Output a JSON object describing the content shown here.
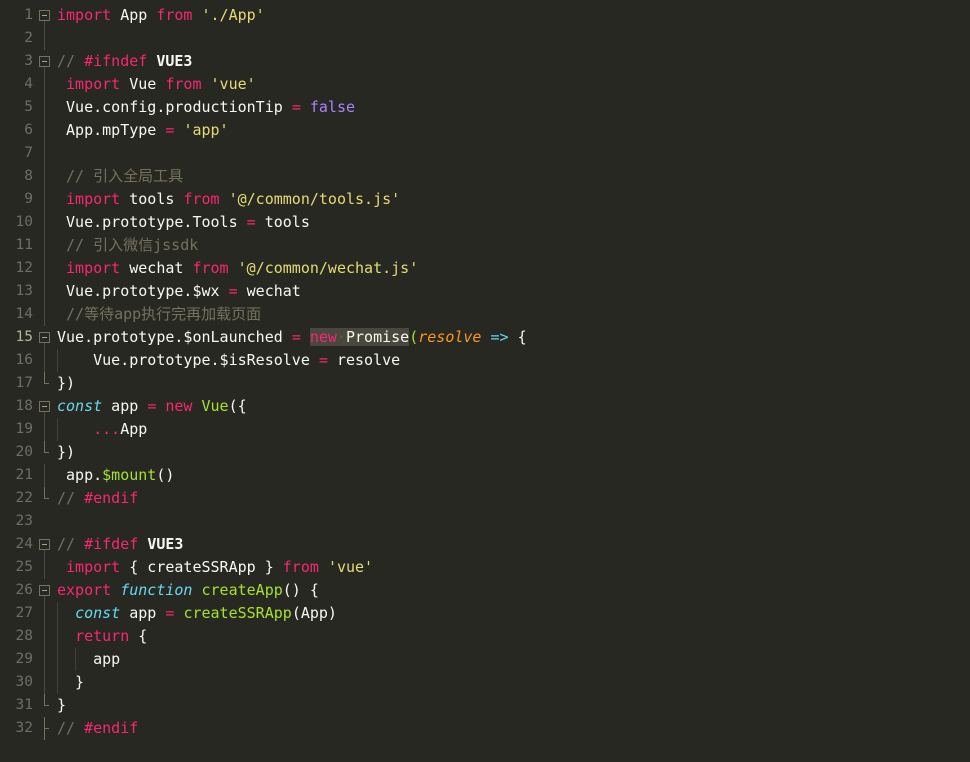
{
  "editor": {
    "theme_name": "monokai",
    "background": "#272822",
    "foreground": "#f8f8f2",
    "gutter_color": "#6d6f63",
    "active_gutter_color": "#b4b49f",
    "selection_background": "#49483e",
    "total_lines": 32,
    "active_line": 15,
    "colors": {
      "keyword": "#f92672",
      "storage": "#66d9ef",
      "string": "#e6db74",
      "comment": "#75715e",
      "constant": "#ae81ff",
      "function": "#a6e22e",
      "parameter": "#fd971f",
      "plain": "#f8f8f2"
    }
  },
  "lines": [
    {
      "number": "1",
      "fold": "open",
      "guides": 0,
      "tokens": [
        {
          "text": "import",
          "cls": "t-kw"
        },
        {
          "text": " App ",
          "cls": "t-plain"
        },
        {
          "text": "from",
          "cls": "t-kw"
        },
        {
          "text": " ",
          "cls": "t-plain"
        },
        {
          "text": "'./App'",
          "cls": "t-str"
        }
      ]
    },
    {
      "number": "2",
      "fold": "bar",
      "guides": 0,
      "tokens": []
    },
    {
      "number": "3",
      "fold": "open",
      "guides": 0,
      "tokens": [
        {
          "text": "// ",
          "cls": "t-com"
        },
        {
          "text": "#ifndef",
          "cls": "t-kw"
        },
        {
          "text": " ",
          "cls": "t-plain"
        },
        {
          "text": "VUE3",
          "cls": "t-bold"
        }
      ]
    },
    {
      "number": "4",
      "fold": "bar",
      "guides": 0,
      "tokens": [
        {
          "text": " ",
          "cls": "t-plain"
        },
        {
          "text": "import",
          "cls": "t-kw"
        },
        {
          "text": " Vue ",
          "cls": "t-plain"
        },
        {
          "text": "from",
          "cls": "t-kw"
        },
        {
          "text": " ",
          "cls": "t-plain"
        },
        {
          "text": "'vue'",
          "cls": "t-str"
        }
      ]
    },
    {
      "number": "5",
      "fold": "bar",
      "guides": 0,
      "tokens": [
        {
          "text": " Vue.config.productionTip ",
          "cls": "t-plain"
        },
        {
          "text": "=",
          "cls": "t-op"
        },
        {
          "text": " ",
          "cls": "t-plain"
        },
        {
          "text": "false",
          "cls": "t-num"
        }
      ]
    },
    {
      "number": "6",
      "fold": "bar",
      "guides": 0,
      "tokens": [
        {
          "text": " App.mpType ",
          "cls": "t-plain"
        },
        {
          "text": "=",
          "cls": "t-op"
        },
        {
          "text": " ",
          "cls": "t-plain"
        },
        {
          "text": "'app'",
          "cls": "t-str"
        }
      ]
    },
    {
      "number": "7",
      "fold": "bar",
      "guides": 0,
      "tokens": []
    },
    {
      "number": "8",
      "fold": "bar",
      "guides": 0,
      "tokens": [
        {
          "text": " // 引入全局工具",
          "cls": "t-com"
        }
      ]
    },
    {
      "number": "9",
      "fold": "bar",
      "guides": 0,
      "tokens": [
        {
          "text": " ",
          "cls": "t-plain"
        },
        {
          "text": "import",
          "cls": "t-kw"
        },
        {
          "text": " tools ",
          "cls": "t-plain"
        },
        {
          "text": "from",
          "cls": "t-kw"
        },
        {
          "text": " ",
          "cls": "t-plain"
        },
        {
          "text": "'@/common/tools.js'",
          "cls": "t-str"
        }
      ]
    },
    {
      "number": "10",
      "fold": "bar",
      "guides": 0,
      "tokens": [
        {
          "text": " Vue.prototype.Tools ",
          "cls": "t-plain"
        },
        {
          "text": "=",
          "cls": "t-op"
        },
        {
          "text": " tools",
          "cls": "t-plain"
        }
      ]
    },
    {
      "number": "11",
      "fold": "bar",
      "guides": 0,
      "tokens": [
        {
          "text": " // 引入微信jssdk",
          "cls": "t-com"
        }
      ]
    },
    {
      "number": "12",
      "fold": "bar",
      "guides": 0,
      "tokens": [
        {
          "text": " ",
          "cls": "t-plain"
        },
        {
          "text": "import",
          "cls": "t-kw"
        },
        {
          "text": " wechat ",
          "cls": "t-plain"
        },
        {
          "text": "from",
          "cls": "t-kw"
        },
        {
          "text": " ",
          "cls": "t-plain"
        },
        {
          "text": "'@/common/wechat.js'",
          "cls": "t-str"
        }
      ]
    },
    {
      "number": "13",
      "fold": "bar",
      "guides": 0,
      "tokens": [
        {
          "text": " Vue.prototype.$wx ",
          "cls": "t-plain"
        },
        {
          "text": "=",
          "cls": "t-op"
        },
        {
          "text": " wechat",
          "cls": "t-plain"
        }
      ]
    },
    {
      "number": "14",
      "fold": "bar",
      "guides": 0,
      "tokens": [
        {
          "text": " //等待app执行完再加载页面",
          "cls": "t-com"
        }
      ]
    },
    {
      "number": "15",
      "fold": "open",
      "active": true,
      "guides": 0,
      "tokens": [
        {
          "text": "Vue.prototype.$onLaunched ",
          "cls": "t-plain"
        },
        {
          "text": "=",
          "cls": "t-op"
        },
        {
          "text": " ",
          "cls": "t-plain"
        },
        {
          "text": "new",
          "cls": "t-kw",
          "sel": true
        },
        {
          "text": "·",
          "cls": "ws-dot",
          "sel": true
        },
        {
          "text": "Promise",
          "cls": "t-plain",
          "sel": true
        },
        {
          "text": "(",
          "cls": "t-fn"
        },
        {
          "text": "resolve",
          "cls": "t-param"
        },
        {
          "text": " ",
          "cls": "t-plain"
        },
        {
          "text": "=>",
          "cls": "t-arrow"
        },
        {
          "text": " {",
          "cls": "t-punc"
        }
      ]
    },
    {
      "number": "16",
      "fold": "bar",
      "guides": 1,
      "tokens": [
        {
          "text": "    Vue.prototype.$isResolve ",
          "cls": "t-plain"
        },
        {
          "text": "=",
          "cls": "t-op"
        },
        {
          "text": " resolve",
          "cls": "t-plain"
        }
      ]
    },
    {
      "number": "17",
      "fold": "end",
      "guides": 0,
      "tokens": [
        {
          "text": "})",
          "cls": "t-punc"
        }
      ]
    },
    {
      "number": "18",
      "fold": "open",
      "guides": 0,
      "tokens": [
        {
          "text": "const",
          "cls": "t-kw2"
        },
        {
          "text": " app ",
          "cls": "t-plain"
        },
        {
          "text": "=",
          "cls": "t-op"
        },
        {
          "text": " ",
          "cls": "t-plain"
        },
        {
          "text": "new",
          "cls": "t-kw"
        },
        {
          "text": " ",
          "cls": "t-plain"
        },
        {
          "text": "Vue",
          "cls": "t-fn"
        },
        {
          "text": "({",
          "cls": "t-punc"
        }
      ]
    },
    {
      "number": "19",
      "fold": "bar",
      "guides": 1,
      "tokens": [
        {
          "text": "    ",
          "cls": "t-plain"
        },
        {
          "text": "...",
          "cls": "t-kw"
        },
        {
          "text": "App",
          "cls": "t-plain"
        }
      ]
    },
    {
      "number": "20",
      "fold": "end",
      "guides": 0,
      "tokens": [
        {
          "text": "})",
          "cls": "t-punc"
        }
      ]
    },
    {
      "number": "21",
      "fold": "bar",
      "guides": 0,
      "tokens": [
        {
          "text": " app.",
          "cls": "t-plain"
        },
        {
          "text": "$mount",
          "cls": "t-fn"
        },
        {
          "text": "()",
          "cls": "t-punc"
        }
      ]
    },
    {
      "number": "22",
      "fold": "end",
      "guides": 0,
      "tokens": [
        {
          "text": "// ",
          "cls": "t-com"
        },
        {
          "text": "#endif",
          "cls": "t-kw"
        }
      ]
    },
    {
      "number": "23",
      "fold": "none",
      "guides": 0,
      "tokens": []
    },
    {
      "number": "24",
      "fold": "open",
      "guides": 0,
      "tokens": [
        {
          "text": "// ",
          "cls": "t-com"
        },
        {
          "text": "#ifdef",
          "cls": "t-kw"
        },
        {
          "text": " ",
          "cls": "t-plain"
        },
        {
          "text": "VUE3",
          "cls": "t-bold"
        }
      ]
    },
    {
      "number": "25",
      "fold": "bar",
      "guides": 0,
      "tokens": [
        {
          "text": " ",
          "cls": "t-plain"
        },
        {
          "text": "import",
          "cls": "t-kw"
        },
        {
          "text": " { createSSRApp } ",
          "cls": "t-plain"
        },
        {
          "text": "from",
          "cls": "t-kw"
        },
        {
          "text": " ",
          "cls": "t-plain"
        },
        {
          "text": "'vue'",
          "cls": "t-str"
        }
      ]
    },
    {
      "number": "26",
      "fold": "open",
      "guides": 0,
      "tokens": [
        {
          "text": "export",
          "cls": "t-kw"
        },
        {
          "text": " ",
          "cls": "t-plain"
        },
        {
          "text": "function",
          "cls": "t-kw2"
        },
        {
          "text": " ",
          "cls": "t-plain"
        },
        {
          "text": "createApp",
          "cls": "t-fn"
        },
        {
          "text": "() {",
          "cls": "t-punc"
        }
      ]
    },
    {
      "number": "27",
      "fold": "bar",
      "guides": 1,
      "tokens": [
        {
          "text": "  ",
          "cls": "t-plain"
        },
        {
          "text": "const",
          "cls": "t-kw2"
        },
        {
          "text": " app ",
          "cls": "t-plain"
        },
        {
          "text": "=",
          "cls": "t-op"
        },
        {
          "text": " ",
          "cls": "t-plain"
        },
        {
          "text": "createSSRApp",
          "cls": "t-fn"
        },
        {
          "text": "(App)",
          "cls": "t-punc"
        }
      ]
    },
    {
      "number": "28",
      "fold": "bar",
      "guides": 1,
      "tokens": [
        {
          "text": "  ",
          "cls": "t-plain"
        },
        {
          "text": "return",
          "cls": "t-kw"
        },
        {
          "text": " {",
          "cls": "t-punc"
        }
      ]
    },
    {
      "number": "29",
      "fold": "bar",
      "guides": 2,
      "tokens": [
        {
          "text": "    app",
          "cls": "t-plain"
        }
      ]
    },
    {
      "number": "30",
      "fold": "bar",
      "guides": 1,
      "tokens": [
        {
          "text": "  }",
          "cls": "t-punc"
        }
      ]
    },
    {
      "number": "31",
      "fold": "end",
      "guides": 0,
      "tokens": [
        {
          "text": "}",
          "cls": "t-punc"
        }
      ]
    },
    {
      "number": "32",
      "fold": "end-full",
      "guides": 0,
      "tokens": [
        {
          "text": "// ",
          "cls": "t-com"
        },
        {
          "text": "#endif",
          "cls": "t-kw"
        }
      ]
    }
  ]
}
